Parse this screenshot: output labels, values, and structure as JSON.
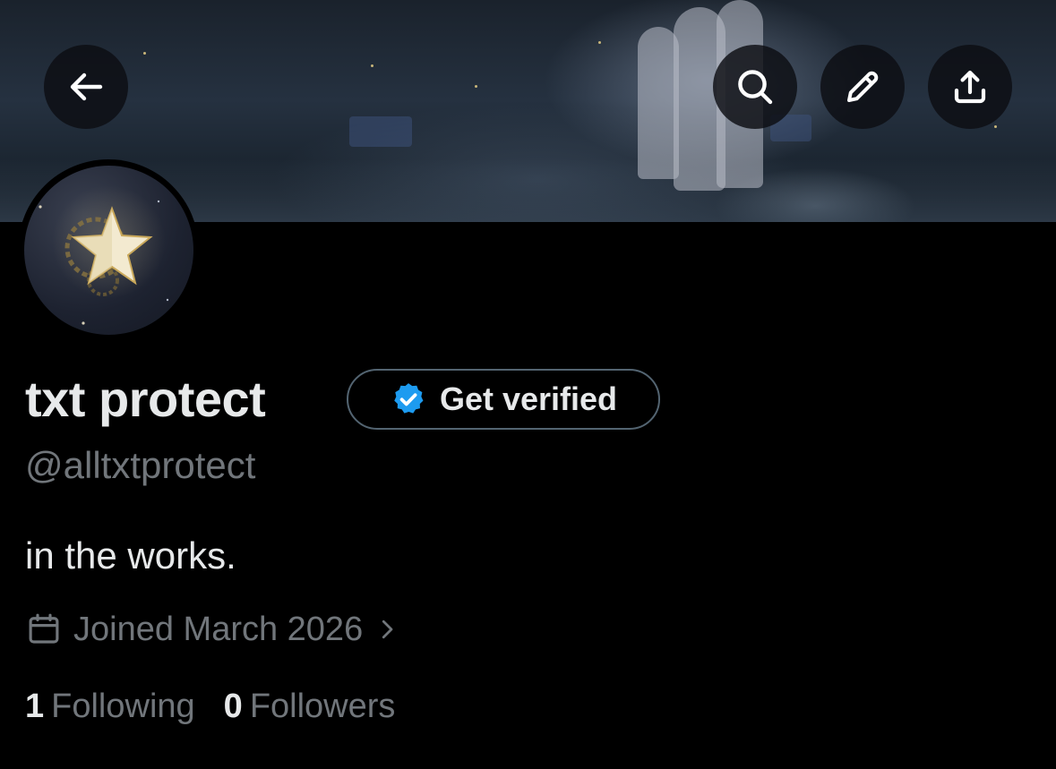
{
  "header": {
    "back_icon": "arrow-left-icon",
    "search_icon": "search-icon",
    "edit_icon": "pencil-icon",
    "share_icon": "share-upload-icon"
  },
  "profile": {
    "display_name": "txt protect",
    "handle": "@alltxtprotect",
    "bio": "in the works.",
    "joined": "Joined March 2026",
    "verify_button": {
      "label": "Get verified",
      "icon": "verified-badge-icon",
      "badge_color": "#1d9bf0"
    },
    "stats": {
      "following_count": "1",
      "following_label": "Following",
      "followers_count": "0",
      "followers_label": "Followers"
    }
  },
  "colors": {
    "background": "#000000",
    "primary_text": "#e7e9ea",
    "secondary_text": "#71767b",
    "button_border": "#536471",
    "accent": "#1d9bf0"
  }
}
